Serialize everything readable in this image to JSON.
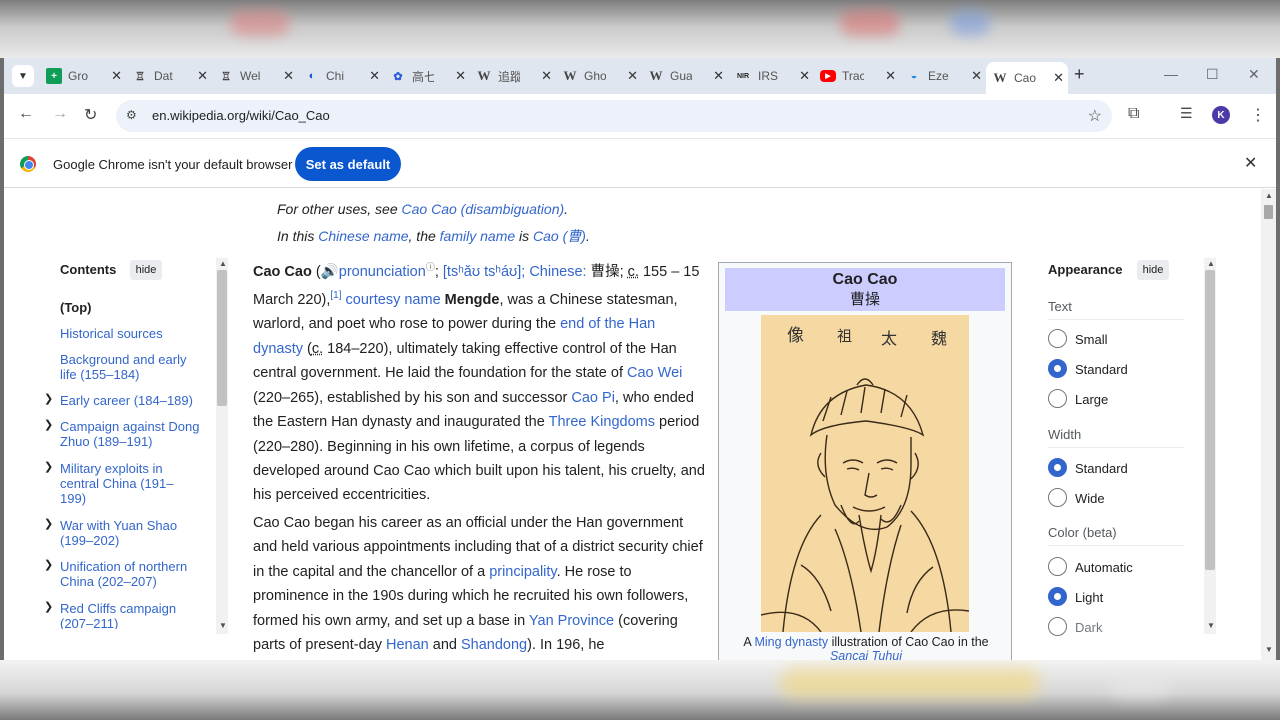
{
  "tabs": [
    {
      "title": "Gro",
      "favicon": "G"
    },
    {
      "title": "Dat",
      "favicon": "♖"
    },
    {
      "title": "Wel",
      "favicon": "♖"
    },
    {
      "title": "Chi",
      "favicon": "◐"
    },
    {
      "title": "高七",
      "favicon": "✿"
    },
    {
      "title": "追蹤",
      "favicon": "W"
    },
    {
      "title": "Gho",
      "favicon": "W"
    },
    {
      "title": "Gua",
      "favicon": "W"
    },
    {
      "title": "IRS",
      "favicon": "NIR"
    },
    {
      "title": "Trac",
      "favicon": "▶"
    },
    {
      "title": "Eze",
      "favicon": "◒"
    },
    {
      "title": "Cao",
      "favicon": "W"
    }
  ],
  "address_bar": {
    "url": "en.wikipedia.org/wiki/Cao_Cao"
  },
  "infobar": {
    "message": "Google Chrome isn't your default browser",
    "button": "Set as default"
  },
  "profile_initial": "K",
  "hatnote": {
    "line1_prefix": "For other uses, see ",
    "line1_link": "Cao Cao (disambiguation)",
    "line1_suffix": ".",
    "line2_a": "In this ",
    "line2_link1": "Chinese name",
    "line2_b": ", the ",
    "line2_link2": "family name",
    "line2_c": " is ",
    "line2_link3": "Cao (曹)",
    "line2_d": "."
  },
  "toc": {
    "title": "Contents",
    "hide": "hide",
    "items": [
      "(Top)",
      "Historical sources",
      "Background and early life (155–184)",
      "Early career (184–189)",
      "Campaign against Dong Zhuo (189–191)",
      "Military exploits in central China (191–199)",
      "War with Yuan Shao (199–202)",
      "Unification of northern China (202–207)",
      "Red Cliffs campaign (207–211)"
    ]
  },
  "article": {
    "p1": {
      "name": "Cao Cao",
      "pron": "pronunciation",
      "ipa": "[tsʰǎʊ tsʰáʊ]; Chinese:",
      "chinese": "曹操",
      "circa": "c.",
      "dates": "155 – 15 March 220),",
      "ref": "[1]",
      "courtesy": "courtesy name",
      "mengde": "Mengde",
      "t1": ", was a Chinese statesman, warlord, and poet who rose to power during the ",
      "link_end_han": "end of the Han dynasty",
      "t2": " (",
      "circa2": "c.",
      "t3": " 184–220), ultimately taking effective control of the Han central government. He laid the foundation for the state of ",
      "link_cao_wei": "Cao Wei",
      "t4": " (220–265), established by his son and successor ",
      "link_cao_pi": "Cao Pi",
      "t5": ", who ended the Eastern Han dynasty and inaugurated the ",
      "link_three_kingdoms": "Three Kingdoms",
      "t6": " period (220–280). Beginning in his own lifetime, a corpus of legends developed around Cao Cao which built upon his talent, his cruelty, and his perceived eccentricities."
    },
    "p2": {
      "t1": "Cao Cao began his career as an official under the Han government and held various appointments including that of a district security chief in the capital and the chancellor of a ",
      "link_principality": "principality",
      "t2": ". He rose to prominence in the 190s during which he recruited his own followers, formed his own army, and set up a base in ",
      "link_yan": "Yan Province",
      "t3": " (covering parts of present-day ",
      "link_henan": "Henan",
      "t4": " and ",
      "link_shandong": "Shandong",
      "t5": "). In 196, he"
    }
  },
  "infobox": {
    "title_en": "Cao Cao",
    "title_zh": "曹操",
    "portrait_chars": [
      "像",
      "祖",
      "太",
      "魏"
    ],
    "caption_a": "A ",
    "caption_link": "Ming dynasty",
    "caption_b": " illustration of Cao Cao in the",
    "caption_c": "Sancai Tuhui"
  },
  "appearance": {
    "title": "Appearance",
    "hide": "hide",
    "text_label": "Text",
    "text_options": [
      "Small",
      "Standard",
      "Large"
    ],
    "text_selected": "Standard",
    "width_label": "Width",
    "width_options": [
      "Standard",
      "Wide"
    ],
    "width_selected": "Standard",
    "color_label": "Color (beta)",
    "color_options": [
      "Automatic",
      "Light",
      "Dark"
    ],
    "color_selected": "Light"
  }
}
